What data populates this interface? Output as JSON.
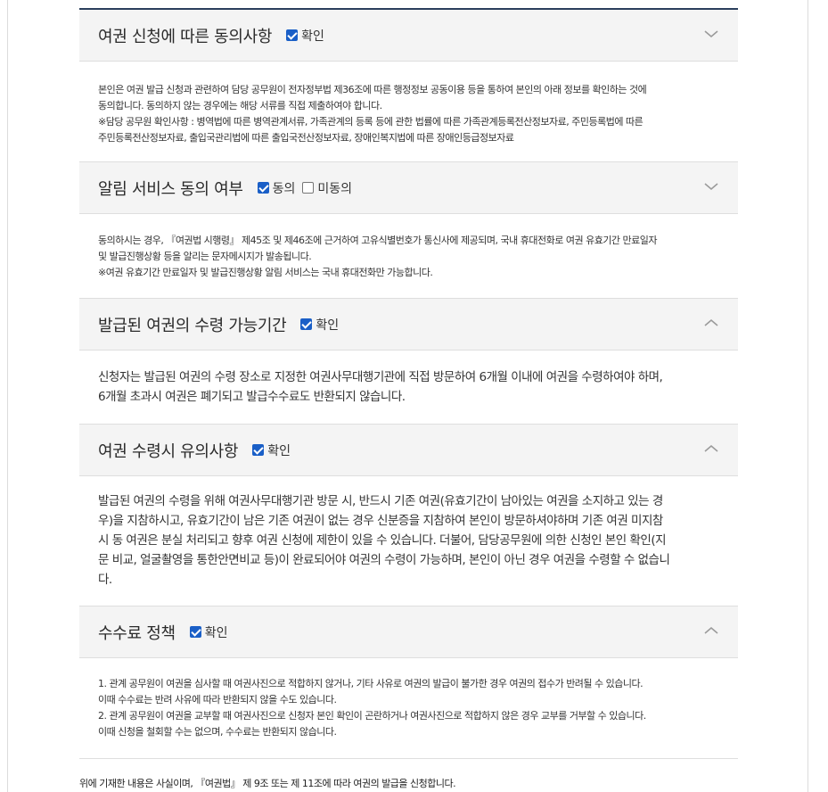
{
  "sections": [
    {
      "title": "여권 신청에 따른 동의사항",
      "checks": [
        {
          "label": "확인",
          "checked": true
        }
      ],
      "expanded": false,
      "lines": [
        "본인은 여권 발급 신청과 관련하여 담당 공무원이 전자정부법 제36조에 따른 행정정보 공동이용 등을 통하여 본인의 아래 정보를 확인하는 것에",
        "동의합니다. 동의하지 않는 경우에는 해당 서류를 직접 제출하여야 합니다.",
        "※담당 공무원 확인사항 : 병역법에 따른 병역관계서류, 가족관계의 등록 등에 관한 법률에 따른 가족관계등록전산정보자료, 주민등록법에 따른",
        "주민등록전산정보자료, 출입국관리법에 따른 출입국전산정보자료, 장애인복지법에 따른 장애인등급정보자료"
      ]
    },
    {
      "title": "알림 서비스 동의 여부",
      "checks": [
        {
          "label": "동의",
          "checked": true
        },
        {
          "label": "미동의",
          "checked": false
        }
      ],
      "expanded": false,
      "lines": [
        "동의하시는 경우, 『여권법 시행령』 제45조 및 제46조에 근거하여 고유식별번호가 통신사에 제공되며, 국내 휴대전화로 여권 유효기간 만료일자",
        "및 발급진행상황 등을 알리는 문자메시지가 발송됩니다.",
        "※여권 유효기간 만료일자 및 발급진행상황 알림 서비스는 국내 휴대전화만 가능합니다."
      ]
    },
    {
      "title": "발급된 여권의 수령 가능기간",
      "checks": [
        {
          "label": "확인",
          "checked": true
        }
      ],
      "expanded": true,
      "lines": [
        "신청자는 발급된 여권의 수령 장소로 지정한 여권사무대행기관에 직접 방문하여 6개월 이내에 여권을 수령하여야 하며,",
        "6개월 초과시 여권은 폐기되고 발급수수료도 반환되지 않습니다."
      ]
    },
    {
      "title": "여권 수령시 유의사항",
      "checks": [
        {
          "label": "확인",
          "checked": true
        }
      ],
      "expanded": true,
      "lines": [
        "발급된 여권의 수령을 위해 여권사무대행기관 방문 시, 반드시 기존 여권(유효기간이 남아있는 여권을 소지하고 있는 경",
        "우)을 지참하시고, 유효기간이 남은 기존 여권이 없는 경우 신분증을 지참하여 본인이 방문하셔야하며 기존 여권 미지참",
        "시 동 여권은 분실 처리되고 향후 여권 신청에 제한이 있을 수 있습니다. 더불어, 담당공무원에 의한 신청인 본인 확인(지",
        "문 비교, 얼굴촬영을 통한안면비교 등)이 완료되어야 여권의 수령이 가능하며, 본인이 아닌 경우 여권을 수령할 수 없습니",
        "다."
      ]
    },
    {
      "title": "수수료 정책",
      "checks": [
        {
          "label": "확인",
          "checked": true
        }
      ],
      "expanded": true,
      "lines": [
        "1. 관계 공무원이 여권을 심사할 때 여권사진으로 적합하지 않거나, 기타 사유로 여권의 발급이 불가한 경우 여권의 접수가 반려될 수 있습니다.",
        "이때 수수료는 반려 사유에 따라 반환되지 않을 수도 있습니다.",
        "2. 관계 공무원이 여권을 교부할 때 여권사진으로 신청자 본인 확인이 곤란하거나 여권사진으로 적합하지 않은 경우 교부를 거부할 수 있습니다.",
        "이때 신청을 철회할 수는 없으며, 수수료는 반환되지 않습니다."
      ]
    }
  ],
  "footer_text": "위에 기재한 내용은 사실이며, 『여권법』 제 9조 또는 제 11조에 따라 여권의 발급을 신청합니다."
}
